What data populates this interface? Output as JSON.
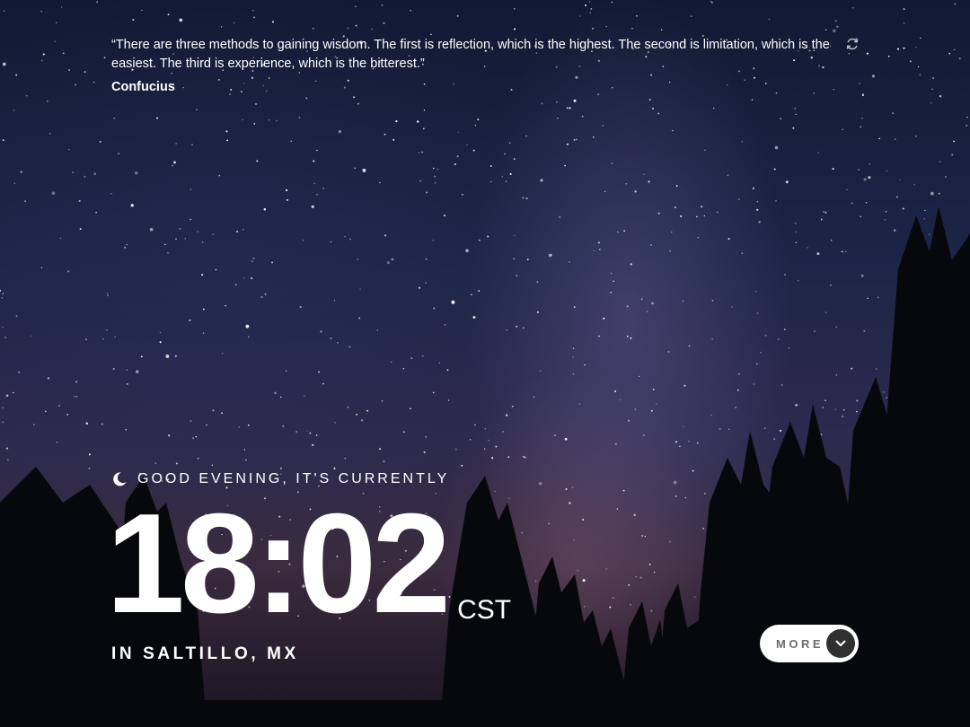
{
  "quote": {
    "text": "“There are three methods to gaining wisdom. The first is reflection, which is the highest. The second is limitation, which is the easiest. The third is experience, which is the bitterest.”",
    "author": "Confucius",
    "refresh_icon": "refresh-icon"
  },
  "greeting": {
    "icon": "moon-icon",
    "text": "GOOD EVENING, IT'S CURRENTLY"
  },
  "clock": {
    "time": "18:02",
    "timezone": "CST"
  },
  "location": "IN SALTILLO, MX",
  "more_button": {
    "label": "MORE",
    "icon": "chevron-down-icon"
  },
  "colors": {
    "text": "#ffffff",
    "button_bg": "#ffffff",
    "button_label": "#6b6b6b",
    "button_circle": "#303030"
  }
}
